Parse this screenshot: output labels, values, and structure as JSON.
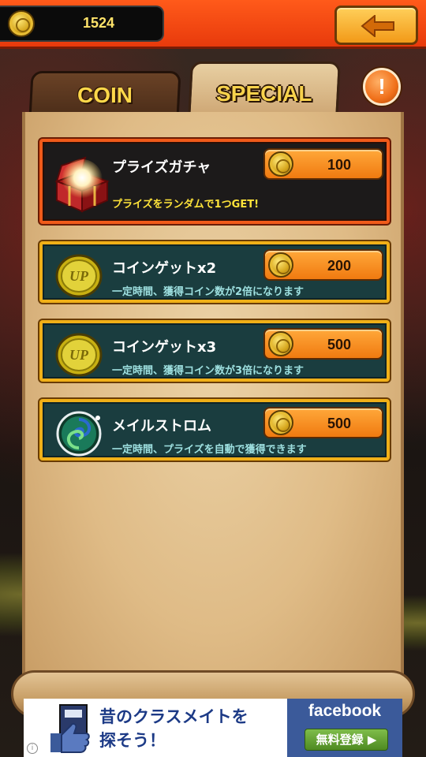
{
  "header": {
    "coin_count": "1524",
    "coin_icon": "gold-coin-icon",
    "back_icon": "arrow-left-icon"
  },
  "tabs": [
    {
      "label": "COIN",
      "active": false
    },
    {
      "label": "SPECIAL",
      "active": true
    }
  ],
  "alert_badge": "!",
  "items": [
    {
      "title": "プライズガチャ",
      "price": "100",
      "description": "プライズをランダムで1つGET!",
      "icon": "treasure-chest-icon"
    },
    {
      "title": "コインゲットx2",
      "price": "200",
      "description": "一定時間、獲得コイン数が2倍になります",
      "icon": "up-coin-icon"
    },
    {
      "title": "コインゲットx3",
      "price": "500",
      "description": "一定時間、獲得コイン数が3倍になります",
      "icon": "up-coin-icon"
    },
    {
      "title": "メイルストロム",
      "price": "500",
      "description": "一定時間、プライズを自動で獲得できます",
      "icon": "maelstrom-orb-icon"
    }
  ],
  "ad": {
    "text_line1": "昔のクラスメイトを",
    "text_line2": "探そう！",
    "brand": "facebook",
    "cta": "無料登録 ▶"
  },
  "colors": {
    "topbar": "#f04a14",
    "featured_border": "#f05a1a",
    "item_border": "#f0b018",
    "item_bg": "#1a3d3f",
    "price_button": "#f08a1a",
    "tab_label": "#ffd84a"
  }
}
